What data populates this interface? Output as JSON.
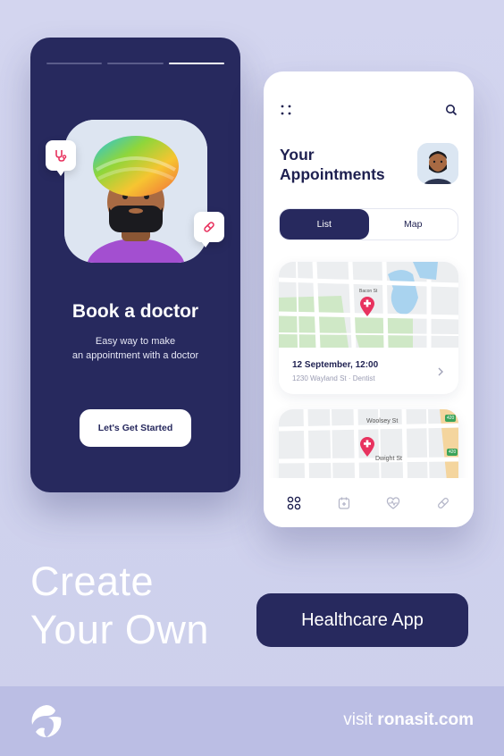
{
  "onboarding": {
    "progress_steps": [
      false,
      false,
      true
    ],
    "title": "Book a doctor",
    "subtitle_line1": "Easy way to make",
    "subtitle_line2": "an appointment with a doctor",
    "start_button": "Let's Get Started"
  },
  "appointments": {
    "title_line1": "Your",
    "title_line2": "Appointments",
    "tabs": [
      {
        "label": "List",
        "active": true
      },
      {
        "label": "Map",
        "active": false
      }
    ],
    "card1": {
      "date": "12 September, 12:00",
      "address": "1230 Wayland St · Dentist",
      "street": "Bacon St"
    },
    "card2": {
      "street1": "Woolsey St",
      "street2": "Dwight St",
      "badge1": "420",
      "badge2": "420"
    },
    "nav_icons": [
      "grid-icon",
      "calendar-icon",
      "heart-icon",
      "pill-icon"
    ]
  },
  "promo": {
    "headline_line1": "Create",
    "headline_line2": "Your Own",
    "cta": "Healthcare App",
    "visit_prefix": "visit ",
    "visit_domain": "ronasit.com"
  },
  "colors": {
    "navy": "#27295e",
    "background": "#cfd2ee",
    "accent_pink": "#e8335f"
  }
}
